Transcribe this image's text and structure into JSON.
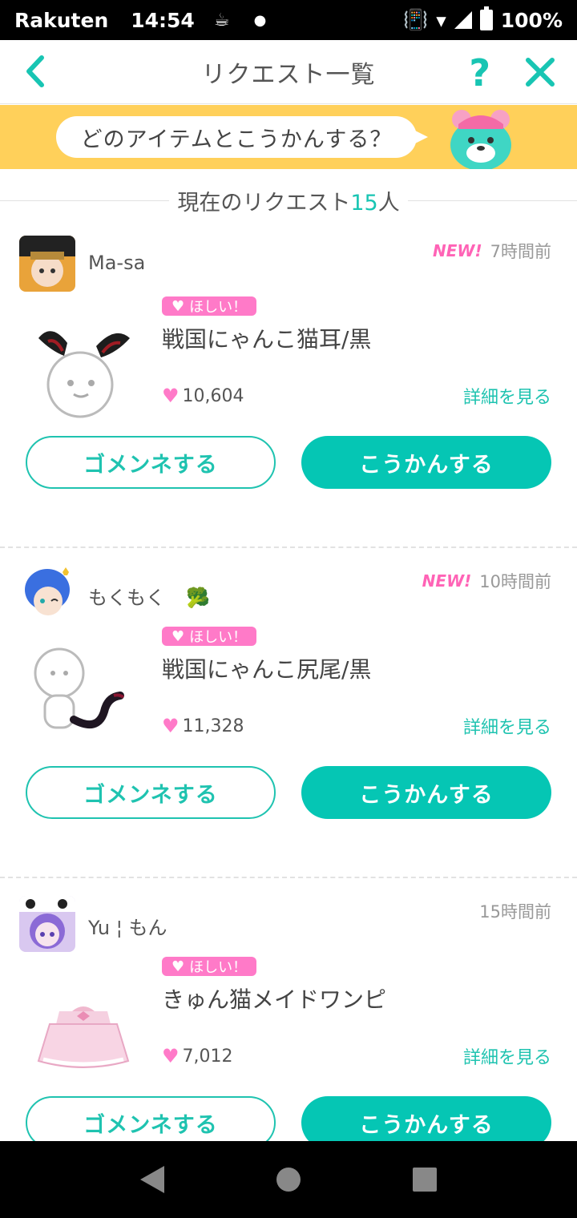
{
  "status_bar": {
    "carrier": "Rakuten",
    "time": "14:54",
    "battery": "100%"
  },
  "header": {
    "title": "リクエスト一覧",
    "help_label": "?",
    "close_label": "×"
  },
  "banner": {
    "bubble_text": "どのアイテムとこうかんする？"
  },
  "section": {
    "prefix": "現在のリクエスト",
    "count": "15",
    "suffix": "人"
  },
  "requests": [
    {
      "username": "Ma-sa",
      "sticker": "",
      "new_badge": "NEW!",
      "time_ago": "7時間前",
      "want_label": "ほしい！",
      "item_name": "戦国にゃんこ猫耳/黒",
      "likes": "10,604",
      "detail_label": "詳細を見る",
      "decline_label": "ゴメンネする",
      "accept_label": "こうかんする"
    },
    {
      "username": "もくもく",
      "sticker": "🥦",
      "new_badge": "NEW!",
      "time_ago": "10時間前",
      "want_label": "ほしい！",
      "item_name": "戦国にゃんこ尻尾/黒",
      "likes": "11,328",
      "detail_label": "詳細を見る",
      "decline_label": "ゴメンネする",
      "accept_label": "こうかんする"
    },
    {
      "username": "Yu ¦ もん",
      "sticker": "",
      "new_badge": "",
      "time_ago": "15時間前",
      "want_label": "ほしい！",
      "item_name": "きゅん猫メイドワンピ",
      "likes": "7,012",
      "detail_label": "詳細を見る",
      "decline_label": "ゴメンネする",
      "accept_label": "こうかんする"
    }
  ],
  "colors": {
    "accent": "#05c6b4",
    "banner": "#ffd05a",
    "pink": "#ff7ac8"
  }
}
